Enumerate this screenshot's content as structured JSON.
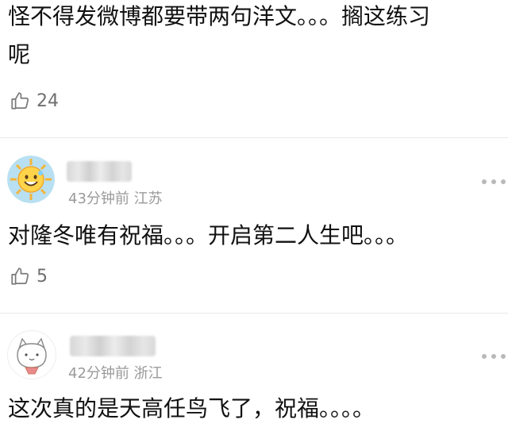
{
  "comments": [
    {
      "text_line1": "怪不得发微博都要带两句洋文。。。搁这练习",
      "text_line2": "呢",
      "likes": "24"
    },
    {
      "time_location": "43分钟前 江苏",
      "text": "对隆冬唯有祝福。。。开启第二人生吧。。。",
      "likes": "5"
    },
    {
      "time_location": "42分钟前 浙江",
      "text": "这次真的是天高任鸟飞了，祝福。。。。"
    }
  ],
  "icons": {
    "like": "thumbs-up-icon",
    "more": "more-dots-icon"
  }
}
